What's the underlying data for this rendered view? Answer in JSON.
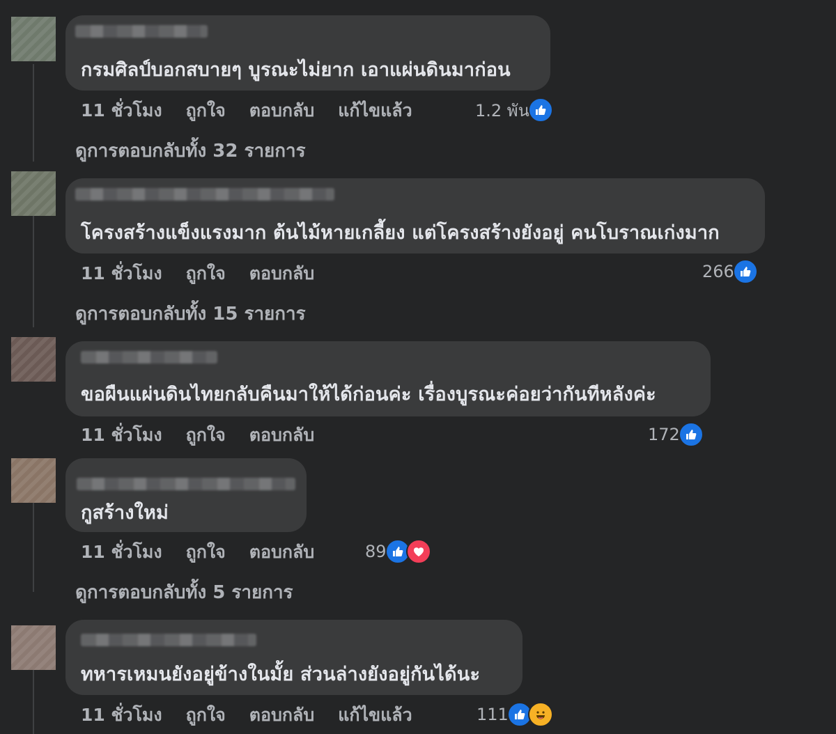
{
  "comments": [
    {
      "text": "กรมศิลป์บอกสบายๆ บูรณะไม่ยาก เอาแผ่นดินมาก่อน",
      "time": "11 ชั่วโมง",
      "like": "ถูกใจ",
      "reply": "ตอบกลับ",
      "edited": "แก้ไขแล้ว",
      "reaction_count": "1.2 พัน",
      "reactions": [
        "like-icon"
      ],
      "view_replies": "ดูการตอบกลับทั้ง 32 รายการ"
    },
    {
      "text": "โครงสร้างแข็งแรงมาก ต้นไม้หายเกลี้ยง แต่โครงสร้างยังอยู่ คนโบราณเก่งมาก",
      "time": "11 ชั่วโมง",
      "like": "ถูกใจ",
      "reply": "ตอบกลับ",
      "reaction_count": "266",
      "reactions": [
        "like-icon"
      ],
      "view_replies": "ดูการตอบกลับทั้ง 15 รายการ"
    },
    {
      "text": "ขอผืนแผ่นดินไทยกลับคืนมาให้ได้ก่อนค่ะ เรื่องบูรณะค่อยว่ากันทีหลังค่ะ",
      "time": "11 ชั่วโมง",
      "like": "ถูกใจ",
      "reply": "ตอบกลับ",
      "reaction_count": "172",
      "reactions": [
        "like-icon"
      ]
    },
    {
      "text": "กูสร้างใหม่",
      "time": "11 ชั่วโมง",
      "like": "ถูกใจ",
      "reply": "ตอบกลับ",
      "reaction_count": "89",
      "reactions": [
        "like-icon",
        "love-icon"
      ],
      "view_replies": "ดูการตอบกลับทั้ง 5 รายการ"
    },
    {
      "text": "ทหารเหมนยังอยู่ข้างในมั้ย ส่วนล่างยังอยู่กันได้นะ",
      "time": "11 ชั่วโมง",
      "like": "ถูกใจ",
      "reply": "ตอบกลับ",
      "edited": "แก้ไขแล้ว",
      "reaction_count": "111",
      "reactions": [
        "like-icon",
        "haha-icon"
      ]
    }
  ],
  "colors": {
    "background": "#242526",
    "bubble": "#3a3b3c",
    "text": "#e4e6eb",
    "secondary": "#b0b3b8",
    "like": "#1b74e4",
    "love": "#f33e58",
    "haha": "#f7b125"
  }
}
